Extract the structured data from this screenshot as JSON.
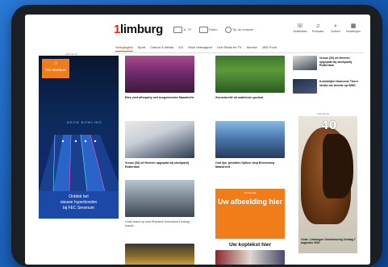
{
  "site": {
    "logo_prefix": "1",
    "logo_text": "limburg",
    "top_links": [
      "1L TV",
      "Radio",
      "Tip de redactie"
    ],
    "utilities": [
      {
        "label": "Notificaties",
        "icon": "bell-icon"
      },
      {
        "label": "Podcasts",
        "icon": "headphones-icon"
      },
      {
        "label": "Zoeken",
        "icon": "search-icon"
      },
      {
        "label": "Instellingen",
        "icon": "grid-icon"
      }
    ]
  },
  "menu": [
    "Voorpagina",
    "Sport",
    "Cultuur & Media",
    "112",
    "Mooi Vertrapport",
    "Live Radio en TV",
    "Service",
    "1BD Food"
  ],
  "ads": {
    "label": "Advertentie",
    "left": {
      "badge": "FEC SEVENUM",
      "neon": "NEON BOWLING",
      "text_lines": [
        "Ontdek het",
        "nieuwe hyperbowlen",
        "bij FEC Sevenum"
      ]
    },
    "right": {
      "big_number": "40",
      "caption": "Oude- Limburgse Ossenkeuring Zondag 7 augustus 2022"
    }
  },
  "articles": [
    {
      "title": "Ries viert afterparty met burgemeester Maastricht"
    },
    {
      "title": "Zonnerbrelle uit watchesin gesloot"
    },
    {
      "title": "Vrouw (30) uit Heerlen opgepakt bij steekpartij Rotterdam"
    },
    {
      "title": "Oud lijsr geslotten Sjöken stop Boerenweg Maastricht"
    },
    {
      "title": "Grote brand op oost Roerkerk Ommeland Limburg brandt..."
    },
    {
      "title": "Vrouw (30) uit Heerlen opgepakt bij steekpartij Rotterdam"
    },
    {
      "title": "Koninklijke Harmonie Thorn straks als tweede op WMC"
    }
  ],
  "promo": {
    "label": "Advertentie",
    "headline": "Uw afbeelding hier",
    "caption": "Uw koptekst hier"
  },
  "colors": {
    "accent": "#e2531a",
    "promo": "#f07d1a",
    "background": "#1a5fb4"
  }
}
